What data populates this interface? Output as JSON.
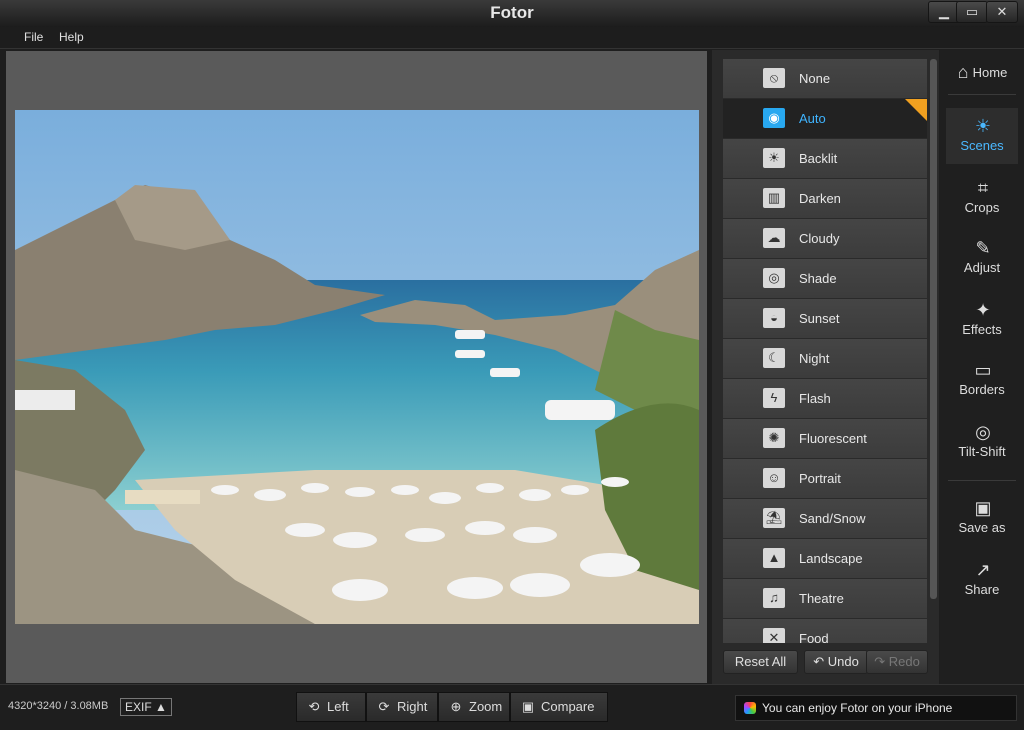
{
  "window": {
    "title": "Fotor",
    "controls": {
      "minimize": "▁",
      "maximize": "▭",
      "close": "✕"
    }
  },
  "menu": [
    "File",
    "Help"
  ],
  "scenes": {
    "items": [
      "None",
      "Auto",
      "Backlit",
      "Darken",
      "Cloudy",
      "Shade",
      "Sunset",
      "Night",
      "Flash",
      "Fluorescent",
      "Portrait",
      "Sand/Snow",
      "Landscape",
      "Theatre",
      "Food"
    ],
    "active_index": 1,
    "reset_label": "Reset All",
    "undo_label": "Undo",
    "redo_label": "Redo"
  },
  "nav": [
    {
      "label": "Home",
      "icon": "house-icon"
    },
    {
      "label": "Scenes",
      "icon": "sun-icon"
    },
    {
      "label": "Crops",
      "icon": "crop-icon"
    },
    {
      "label": "Adjust",
      "icon": "pencil-icon"
    },
    {
      "label": "Effects",
      "icon": "sparkles-icon"
    },
    {
      "label": "Borders",
      "icon": "frame-icon"
    },
    {
      "label": "Tilt-Shift",
      "icon": "target-icon"
    },
    {
      "label": "Save as",
      "icon": "floppy-icon"
    },
    {
      "label": "Share",
      "icon": "share-arrow-icon"
    }
  ],
  "status": {
    "dimensions": "4320*3240 / 3.08MB",
    "exif": "EXIF ▲"
  },
  "toolbar": {
    "left": "Left",
    "right": "Right",
    "zoom": "Zoom",
    "compare": "Compare"
  },
  "promo": "You can enjoy Fotor on your iPhone",
  "colors": {
    "accent": "#3fb4ff",
    "badge": "#f0a020"
  }
}
